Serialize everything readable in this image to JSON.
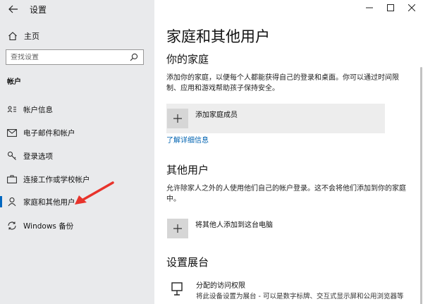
{
  "window": {
    "app_title": "设置",
    "back_icon": "back-arrow-icon"
  },
  "sidebar": {
    "home_label": "主页",
    "search_placeholder": "查找设置",
    "section_label": "帐户",
    "items": [
      {
        "label": "帐户信息",
        "icon": "person-card-icon"
      },
      {
        "label": "电子邮件和帐户",
        "icon": "mail-icon"
      },
      {
        "label": "登录选项",
        "icon": "key-icon"
      },
      {
        "label": "连接工作或学校帐户",
        "icon": "briefcase-icon"
      },
      {
        "label": "家庭和其他用户",
        "icon": "person-icon",
        "active": true
      },
      {
        "label": "Windows 备份",
        "icon": "sync-icon"
      }
    ]
  },
  "main": {
    "title": "家庭和其他用户",
    "family": {
      "heading": "你的家庭",
      "description": "添加你的家庭，以便每个人都能获得自己的登录和桌面。你可以通过时间限制、应用和游戏帮助孩子保持安全。",
      "add_label": "添加家庭成员",
      "learn_more": "了解详细信息"
    },
    "others": {
      "heading": "其他用户",
      "description": "允许除家人之外的人使用他们自己的帐户登录。这不会将他们添加到你的家庭中。",
      "add_label": "将其他人添加到这台电脑"
    },
    "kiosk": {
      "heading": "设置展台",
      "item_title": "分配的访问权限",
      "item_desc": "将此设备设置为展台 - 可以是数字标牌、交互式显示屏和公用浏览器等"
    }
  },
  "colors": {
    "sidebar_bg": "#e9eaec",
    "accent": "#0067c0",
    "link": "#0063b1",
    "annotation_arrow": "#e8332b"
  }
}
